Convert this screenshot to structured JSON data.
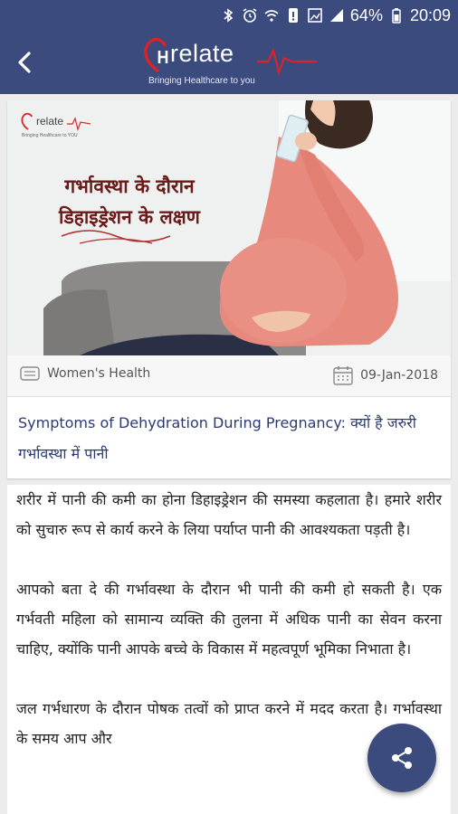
{
  "status_bar": {
    "battery_percent": "64%",
    "time": "20:09",
    "icons": [
      "bluetooth-icon",
      "alarm-icon",
      "wifi-icon",
      "data-saver-icon",
      "screenshot-icon",
      "signal-icon",
      "battery-icon"
    ]
  },
  "app_bar": {
    "logo_text": "relate",
    "tagline": "Bringing Healthcare to you",
    "back_icon": "back-arrow-icon"
  },
  "hero": {
    "logo_text": "relate",
    "logo_tag": "Bringing Healthcare to YOU",
    "title_line1": "गर्भावस्था के दौरान",
    "title_line2": "डिहाइड्रेशन के लक्षण"
  },
  "meta": {
    "category": "Women's Health",
    "date": "09-Jan-2018",
    "category_icon": "category-icon",
    "date_icon": "calendar-icon"
  },
  "article": {
    "title": "Symptoms of Dehydration During Pregnancy: क्यों है जरुरी गर्भावस्था में पानी",
    "paragraphs": [
      "शरीर में पानी की कमी का होना डिहाइड्रेशन की समस्या कहलाता है। हमारे शरीर को सुचारु रूप से कार्य करने के लिया पर्याप्त पानी की आवश्यकता पड़ती है।",
      "आपको बता दे की गर्भावस्था के दौरान भी पानी की कमी हो सकती है। एक गर्भवती महिला को सामान्य व्यक्ति की तुलना में अधिक पानी का सेवन करना चाहिए, क्योंकि पानी आपके बच्चे के विकास में महत्वपूर्ण भूमिका निभाता है।",
      "जल गर्भधारण के दौरान पोषक तत्वों को प्राप्त करने में मदद करता है। गर्भावस्था के समय आप और"
    ]
  },
  "fab": {
    "icon": "share-icon"
  },
  "colors": {
    "primary": "#3c4b7e",
    "title_text": "#2b3a73",
    "hero_title": "#6b1a1a",
    "logo_red": "#d8232a"
  }
}
